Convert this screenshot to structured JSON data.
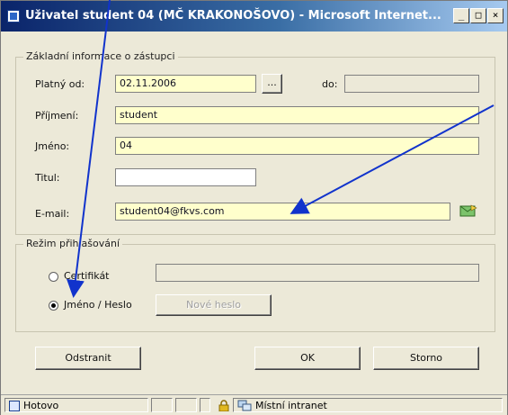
{
  "window": {
    "title": "Uživatel student 04 (MČ KRAKONOŠOVO) - Microsoft Internet...",
    "minimize": "_",
    "maximize": "□",
    "close": "×"
  },
  "basic_info": {
    "legend": "Základní informace o zástupci",
    "valid_from_label": "Platný od:",
    "valid_from_value": "02.11.2006",
    "date_picker_label": "...",
    "valid_to_label": "do:",
    "valid_to_value": "",
    "surname_label": "Příjmení:",
    "surname_value": "student",
    "name_label": "Jméno:",
    "name_value": "04",
    "title_label": "Titul:",
    "title_value": "",
    "email_label": "E-mail:",
    "email_value": "student04@fkvs.com"
  },
  "login_mode": {
    "legend": "Režim přihlašování",
    "certificate_label": "Certifikát",
    "certificate_value": "",
    "name_password_label": "Jméno / Heslo",
    "selected": "name_password",
    "new_password_label": "Nové heslo"
  },
  "buttons": {
    "remove": "Odstranit",
    "ok": "OK",
    "cancel": "Storno"
  },
  "statusbar": {
    "status_text": "Hotovo",
    "zone_text": "Místní intranet"
  },
  "colors": {
    "title_start": "#0a246a",
    "title_end": "#a6caf0",
    "dialog_bg": "#ece9d8",
    "required_field": "#ffffcc",
    "annotation_arrow": "#1133cc"
  }
}
